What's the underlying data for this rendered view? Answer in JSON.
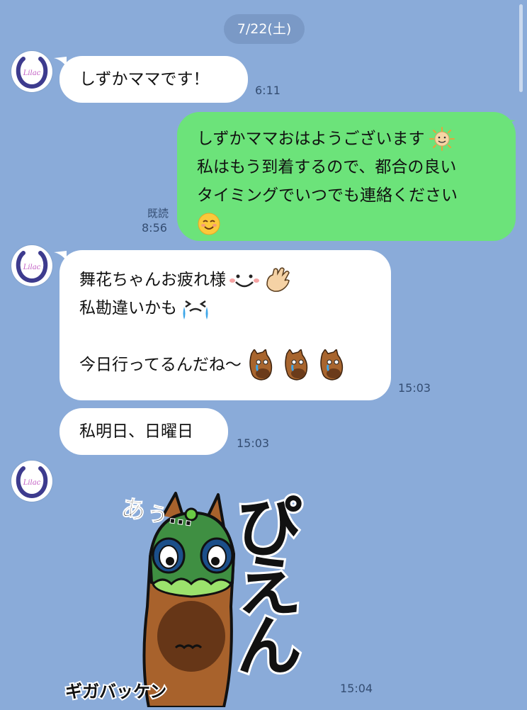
{
  "date": "7/22(土)",
  "messages": [
    {
      "text": "しずかママです！",
      "time": "6:11"
    },
    {
      "lines": [
        "しずかママおはようございます",
        "私はもう到着するので、都合の良い",
        "タイミングでいつでも連絡ください"
      ],
      "read": "既読",
      "time": "8:56"
    },
    {
      "lines": [
        "舞花ちゃんお疲れ様",
        "私勘違いかも",
        "",
        "今日行ってるんだね〜"
      ],
      "time": "15:03"
    },
    {
      "text": "私明日、日曜日",
      "time": "15:03"
    },
    {
      "sticker": {
        "text_main": "ぴえん",
        "text_side": "あぅ…",
        "text_logo": "ギガバッケン"
      },
      "time": "15:04"
    }
  ],
  "avatar": {
    "label": "Lilac"
  },
  "colors": {
    "background": "#8aabd9",
    "incoming": "#ffffff",
    "outgoing": "#6ce37a",
    "pill": "#7a99c6"
  }
}
